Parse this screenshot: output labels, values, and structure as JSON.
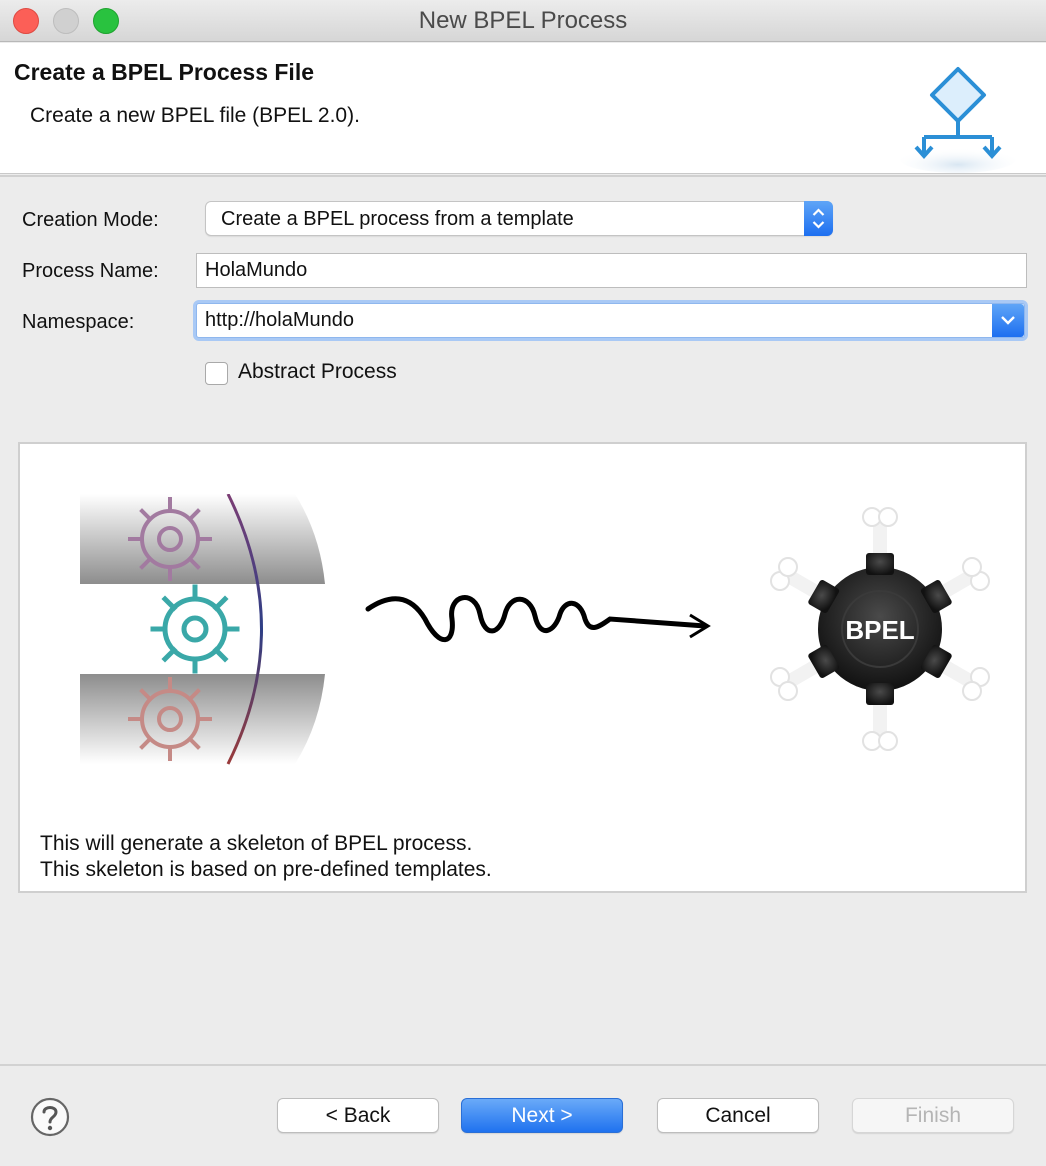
{
  "window": {
    "title": "New BPEL Process"
  },
  "header": {
    "title": "Create a BPEL Process File",
    "description": "Create a new BPEL file (BPEL 2.0)."
  },
  "form": {
    "creation_mode": {
      "label": "Creation Mode:",
      "value": "Create a BPEL process from a template"
    },
    "process_name": {
      "label": "Process Name:",
      "value": "HolaMundo"
    },
    "namespace": {
      "label": "Namespace:",
      "value": "http://holaMundo"
    },
    "abstract_process": {
      "label": "Abstract Process",
      "checked": false
    }
  },
  "preview": {
    "badge_text": "BPEL",
    "line1": "This will generate a skeleton of BPEL process.",
    "line2": "This skeleton is based on pre-defined templates."
  },
  "footer": {
    "back_label": "< Back",
    "next_label": "Next >",
    "cancel_label": "Cancel",
    "finish_label": "Finish"
  },
  "colors": {
    "accent_blue": "#1f72ef",
    "close": "#fc5f57",
    "maximize": "#29c23f",
    "icon_blue": "#2b8fd6"
  }
}
